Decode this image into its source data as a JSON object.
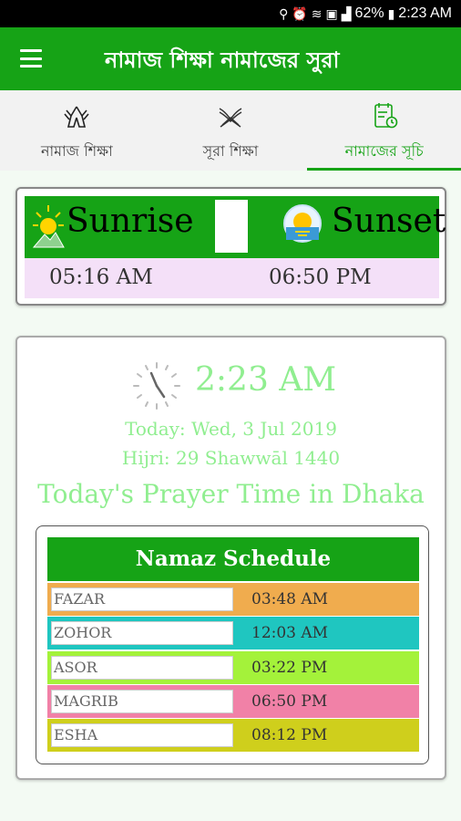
{
  "status_bar": {
    "battery": "62%",
    "time": "2:23 AM"
  },
  "app_bar": {
    "title": "নামাজ শিক্ষা নামাজের সুরা"
  },
  "tabs": [
    {
      "label": "নামাজ শিক্ষা",
      "icon": "praying-hands-icon"
    },
    {
      "label": "সূরা শিক্ষা",
      "icon": "open-quran-icon"
    },
    {
      "label": "নামাজের সূচি",
      "icon": "calendar-clock-icon",
      "active": true
    }
  ],
  "sun_card": {
    "sunrise_label": "Sunrise",
    "sunset_label": "Sunset",
    "sunrise_time": "05:16 AM",
    "sunset_time": "06:50 PM"
  },
  "prayer_card": {
    "clock_time": "2:23 AM",
    "today": "Today: Wed, 3 Jul 2019",
    "hijri": "Hijri: 29 Shawwāl 1440",
    "heading": "Today's Prayer Time in Dhaka",
    "schedule_title": "Namaz Schedule",
    "prayers": [
      {
        "name": "FAZAR",
        "time": "03:48 AM",
        "color": "#f0ac4e"
      },
      {
        "name": "ZOHOR",
        "time": "12:03 AM",
        "color": "#1fc6c0"
      },
      {
        "name": "ASOR",
        "time": "03:22 PM",
        "color": "#a4f23a"
      },
      {
        "name": "MAGRIB",
        "time": "06:50 PM",
        "color": "#f181a7"
      },
      {
        "name": "ESHA",
        "time": "08:12 PM",
        "color": "#cfcf1c"
      }
    ]
  },
  "colors": {
    "primary_green": "#16a316",
    "light_green_text": "#90ee90",
    "sun_times_bg": "#f4e0f8"
  }
}
